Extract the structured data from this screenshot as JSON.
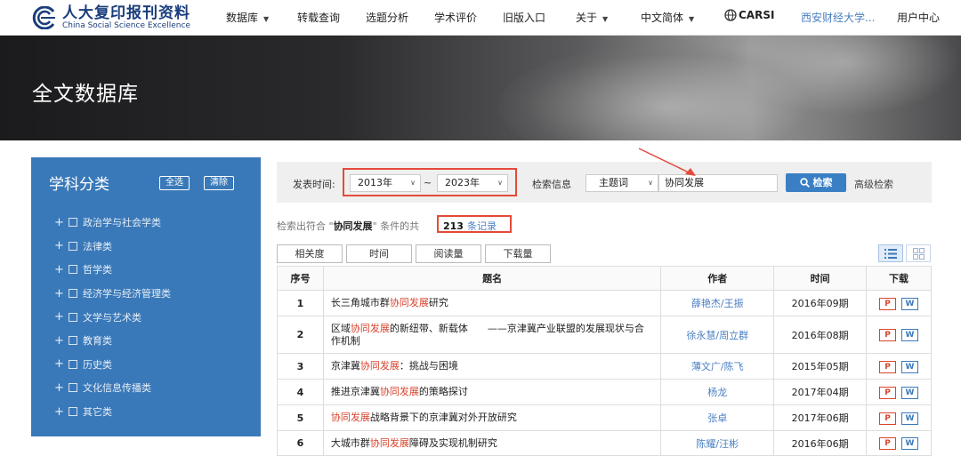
{
  "brand": {
    "name_cn": "人大复印报刊资料",
    "name_en": "China Social Science Excellence"
  },
  "nav": {
    "items": [
      {
        "label": "数据库",
        "dropdown": true
      },
      {
        "label": "转载查询",
        "dropdown": false
      },
      {
        "label": "选题分析",
        "dropdown": false
      },
      {
        "label": "学术评价",
        "dropdown": false
      },
      {
        "label": "旧版入口",
        "dropdown": false
      },
      {
        "label": "关于",
        "dropdown": true
      },
      {
        "label": "中文简体",
        "dropdown": true
      }
    ],
    "carsi": "CARSI",
    "institution": "西安财经大学...",
    "user_center": "用户中心"
  },
  "banner": {
    "title": "全文数据库"
  },
  "sidebar": {
    "title": "学科分类",
    "select_all": "全选",
    "clear": "清除",
    "categories": [
      "政治学与社会学类",
      "法律类",
      "哲学类",
      "经济学与经济管理类",
      "文学与艺术类",
      "教育类",
      "历史类",
      "文化信息传播类",
      "其它类"
    ]
  },
  "search": {
    "date_label": "发表时间:",
    "year_from": "2013年",
    "tilde": "~",
    "year_to": "2023年",
    "info_label": "检索信息",
    "field": "主题词",
    "query": "协同发展",
    "button": "检索",
    "advanced": "高级检索"
  },
  "results": {
    "prefix": "检索出符合 \"",
    "keyword": "协同发展",
    "suffix": "\" 条件的共",
    "count": "213",
    "count_unit": "条记录"
  },
  "sort": [
    "相关度",
    "时间",
    "阅读量",
    "下载量"
  ],
  "table": {
    "headers": [
      "序号",
      "题名",
      "作者",
      "时间",
      "下载"
    ],
    "rows": [
      {
        "num": "1",
        "pre": "长三角城市群",
        "hl": "协同发展",
        "post": "研究",
        "author": "薛艳杰/王振",
        "time": "2016年09期"
      },
      {
        "num": "2",
        "pre": "区域",
        "hl": "协同发展",
        "post": "的新纽带、新载体　　——京津冀产业联盟的发展现状与合作机制",
        "author": "徐永慧/周立群",
        "time": "2016年08期"
      },
      {
        "num": "3",
        "pre": "京津冀",
        "hl": "协同发展",
        "post": "：挑战与困境",
        "author": "薄文广/陈飞",
        "time": "2015年05期"
      },
      {
        "num": "4",
        "pre": "推进京津冀",
        "hl": "协同发展",
        "post": "的策略探讨",
        "author": "杨龙",
        "time": "2017年04期"
      },
      {
        "num": "5",
        "pre": "",
        "hl": "协同发展",
        "post": "战略背景下的京津冀对外开放研究",
        "author": "张卓",
        "time": "2017年06期"
      },
      {
        "num": "6",
        "pre": "大城市群",
        "hl": "协同发展",
        "post": "障碍及实现机制研究",
        "author": "陈耀/汪彬",
        "time": "2016年06期"
      }
    ],
    "download_pdf": "P",
    "download_word": "W"
  },
  "colors": {
    "accent_blue": "#3a79b9",
    "highlight_red": "#d9452f",
    "annotation_red": "#e44a3a"
  }
}
